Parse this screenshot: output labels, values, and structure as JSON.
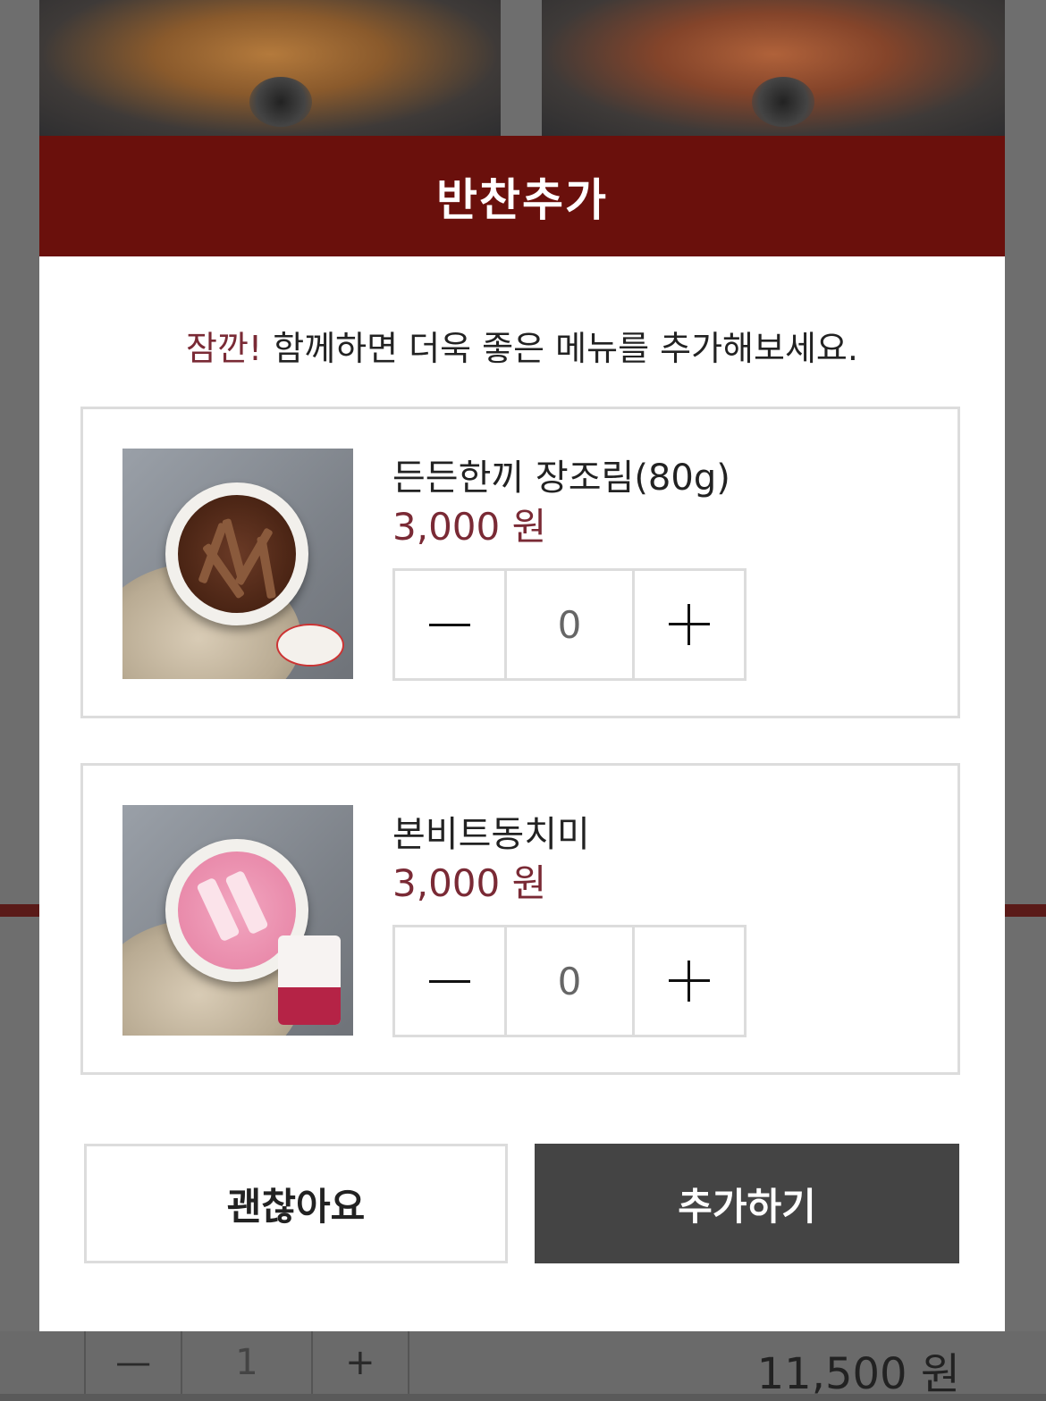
{
  "modal": {
    "title": "반찬추가",
    "subtitle_accent": "잠깐!",
    "subtitle_text": " 함께하면 더욱 좋은 메뉴를 추가해보세요.",
    "items": [
      {
        "name": "든든한끼 장조림(80g)",
        "price": "3,000 원",
        "quantity": "0",
        "image": "braised-beef-bowl"
      },
      {
        "name": "본비트동치미",
        "price": "3,000 원",
        "quantity": "0",
        "image": "beet-dongchimi-bowl"
      }
    ],
    "cancel_label": "괜찮아요",
    "confirm_label": "추가하기"
  },
  "background": {
    "quantity": "1",
    "total_price": "11,500 원"
  },
  "colors": {
    "header": "#6a100c",
    "accent": "#7a2a35",
    "confirm_button": "#444444"
  }
}
